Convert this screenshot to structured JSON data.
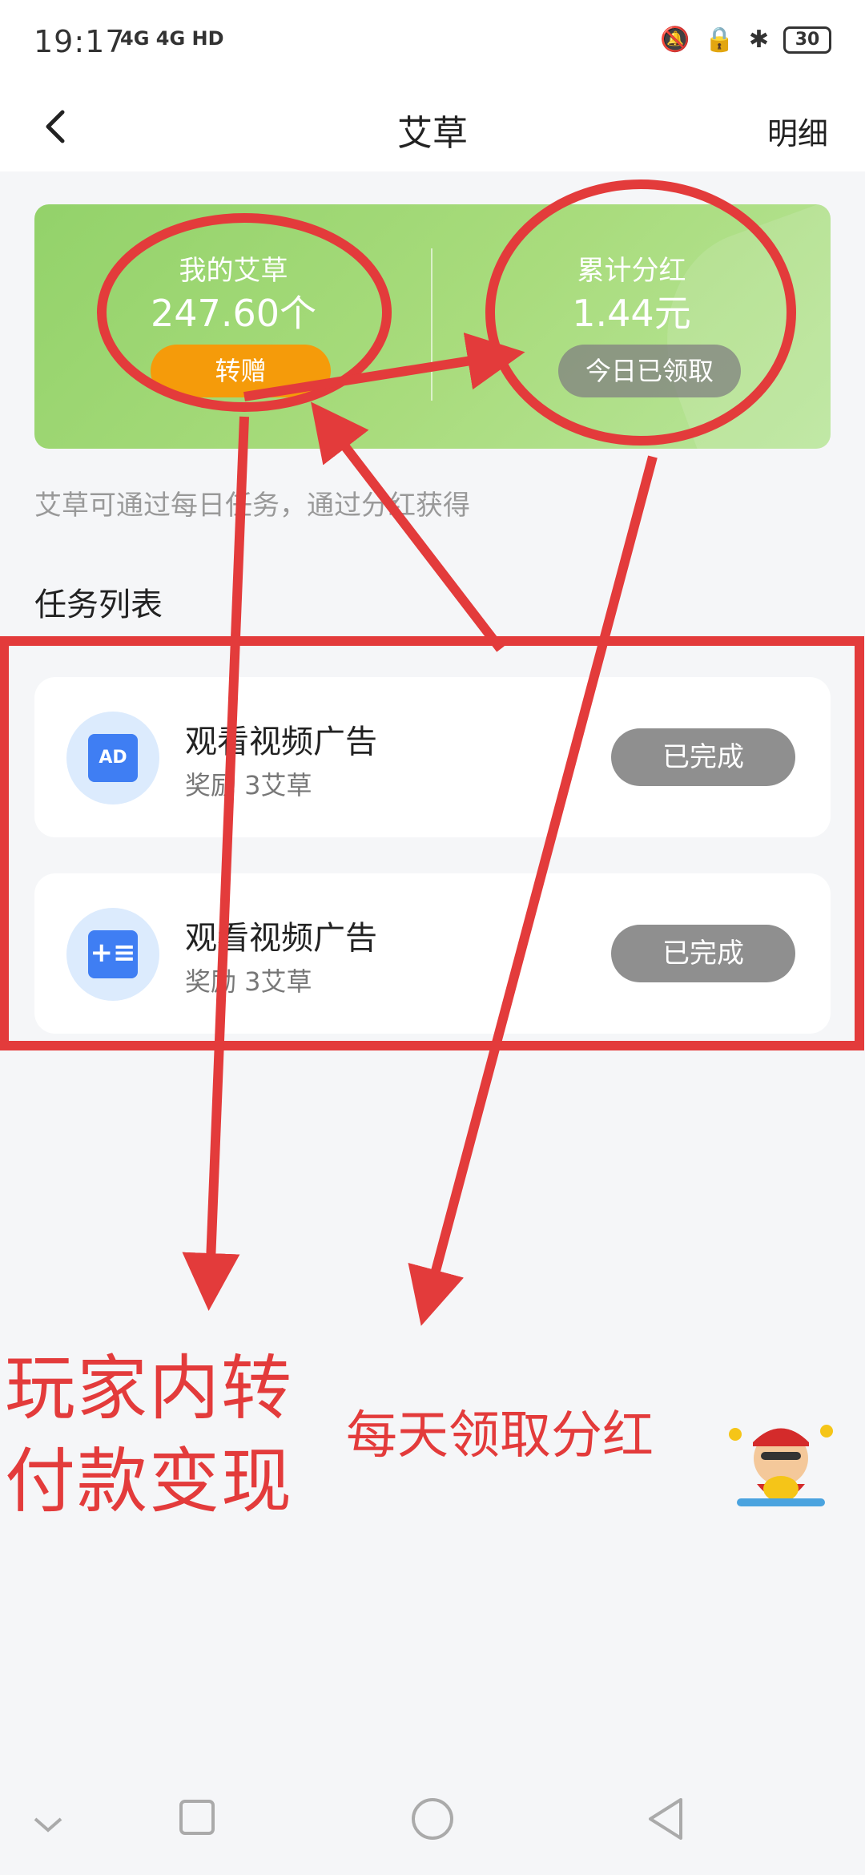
{
  "status_bar": {
    "time": "19:17",
    "network": "4G 4G HD",
    "battery": "30"
  },
  "header": {
    "back_icon": "chevron-left-icon",
    "title": "艾草",
    "detail_label": "明细"
  },
  "summary_card": {
    "my_herb_label": "我的艾草",
    "my_herb_value": "247.60个",
    "transfer_button": "转赠",
    "dividend_label": "累计分红",
    "dividend_value": "1.44元",
    "claimed_button": "今日已领取"
  },
  "hint": "艾草可通过每日任务，通过分红获得",
  "tasks": {
    "section_title": "任务列表",
    "items": [
      {
        "name": "观看视频广告",
        "reward": "奖励 3艾草",
        "icon": "ad-icon",
        "icon_text": "AD",
        "status": "已完成"
      },
      {
        "name": "观看视频广告",
        "reward": "奖励 3艾草",
        "icon": "task-list-icon",
        "icon_text": "+≡",
        "status": "已完成"
      }
    ]
  },
  "annotations": {
    "left_line1": "玩家内转",
    "left_line2": "付款变现",
    "right": "每天领取分红",
    "color": "#e33b3b"
  },
  "system_nav": {
    "icons": [
      "chevron-down-icon",
      "recent-apps-icon",
      "home-icon",
      "back-triangle-icon"
    ]
  }
}
